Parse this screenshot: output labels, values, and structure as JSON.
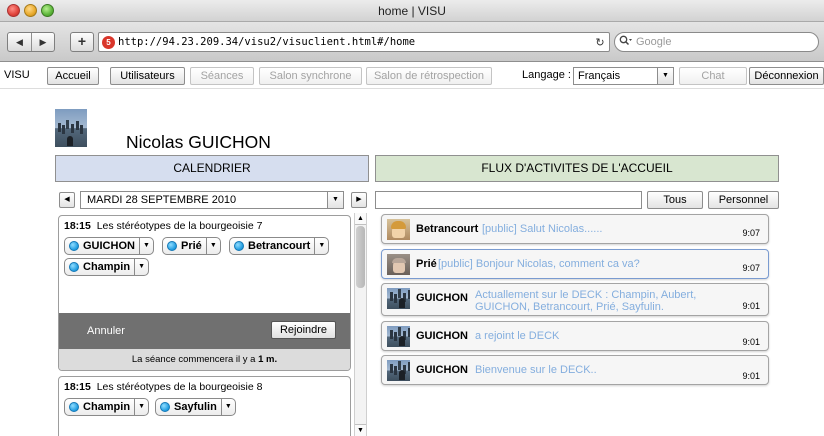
{
  "window": {
    "title": "home | VISU",
    "url": "http://94.23.209.34/visu2/visuclient.html#/home",
    "search_placeholder": "Google",
    "nav_back": "◀",
    "nav_forward": "▶",
    "new_tab": "+",
    "reload": "↻"
  },
  "menubar": {
    "brand": "VISU",
    "buttons": [
      {
        "label": "Accueil",
        "enabled": true
      },
      {
        "label": "Utilisateurs",
        "enabled": true
      },
      {
        "label": "Séances",
        "enabled": false
      },
      {
        "label": "Salon synchrone",
        "enabled": false
      },
      {
        "label": "Salon de rétrospection",
        "enabled": false
      },
      {
        "label": "Chat",
        "enabled": false
      },
      {
        "label": "Déconnexion",
        "enabled": true
      }
    ],
    "language_label": "Langage :",
    "language_value": "Français"
  },
  "profile": {
    "name": "Nicolas GUICHON"
  },
  "calendar": {
    "header": "CALENDRIER",
    "date": "MARDI 28 SEPTEMBRE 2010",
    "sessions": [
      {
        "time": "18:15",
        "title": "Les stéréotypes de la bourgeoisie 7",
        "participants": [
          "GUICHON",
          "Prié",
          "Betrancourt",
          "Champin"
        ],
        "cancel_label": "Annuler",
        "join_label": "Rejoindre",
        "footer_prefix": "La séance commencera il y a",
        "footer_value": "1 m."
      },
      {
        "time": "18:15",
        "title": "Les stéréotypes de la bourgeoisie 8",
        "participants": [
          "Champin",
          "Sayfulin"
        ]
      }
    ]
  },
  "flux": {
    "header": "FLUX D'ACTIVITES DE L'ACCUEIL",
    "filter_all": "Tous",
    "filter_personal": "Personnel",
    "items": [
      {
        "user": "Betrancourt",
        "message": "[public] Salut Nicolas......",
        "time": "9:07"
      },
      {
        "user": "Prié",
        "message": "[public] Bonjour Nicolas, comment ca va?",
        "time": "9:07"
      },
      {
        "user": "GUICHON",
        "message": "Actuallement sur le DECK : Champin, Aubert,",
        "message2": "GUICHON, Betrancourt, Prié, Sayfulin.",
        "time": "9:01"
      },
      {
        "user": "GUICHON",
        "message": "a rejoint le DECK",
        "time": "9:01"
      },
      {
        "user": "GUICHON",
        "message": "Bienvenue sur le DECK..",
        "time": "9:01"
      }
    ]
  },
  "colors": {
    "calendar_header_bg": "#d6deef",
    "flux_header_bg": "#d8e6d0",
    "message_text": "#84aede",
    "session_bar": "#707070"
  }
}
